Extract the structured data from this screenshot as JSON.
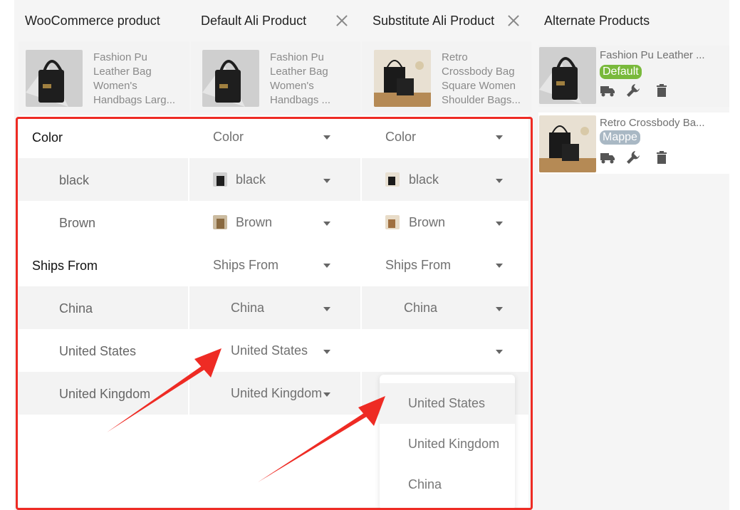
{
  "columns": {
    "woo": "WooCommerce product",
    "default": "Default Ali Product",
    "substitute": "Substitute Ali Product",
    "alternates": "Alternate Products"
  },
  "products": {
    "woo": [
      "Fashion Pu",
      "Leather Bag",
      "Women's",
      "Handbags Larg..."
    ],
    "default": [
      "Fashion Pu",
      "Leather Bag",
      "Women's",
      "Handbags ..."
    ],
    "substitute": [
      "Retro",
      "Crossbody Bag",
      "Square Women",
      "Shoulder Bags..."
    ]
  },
  "attributes": {
    "color": {
      "label": "Color",
      "default_select": "Color",
      "substitute_select": "Color",
      "options": [
        {
          "label": "black",
          "default_value": "black",
          "substitute_value": "black"
        },
        {
          "label": "Brown",
          "default_value": "Brown",
          "substitute_value": "Brown"
        }
      ]
    },
    "ships_from": {
      "label": "Ships From",
      "default_select": "Ships From",
      "substitute_select": "Ships From",
      "options": [
        {
          "label": "China",
          "default_value": "China",
          "substitute_value": "China"
        },
        {
          "label": "United States",
          "default_value": "United States",
          "substitute_value": ""
        },
        {
          "label": "United Kingdom",
          "default_value": "United Kingdom",
          "substitute_value": ""
        }
      ]
    }
  },
  "dropdown": {
    "options": [
      "United States",
      "United Kingdom",
      "China"
    ]
  },
  "alternates": [
    {
      "title": "Fashion Pu Leather ...",
      "badge": "Default",
      "badge_color": "#79b93b"
    },
    {
      "title": "Retro Crossbody Ba...",
      "badge": "Mappe",
      "badge_color": "#a9b8c4"
    }
  ],
  "colors": {
    "highlight": "#ee2b24",
    "default_badge": "#79b93b",
    "mapped_badge": "#a9b8c4"
  },
  "icons": [
    "close-icon",
    "truck-icon",
    "wrench-icon",
    "trash-icon",
    "caret-down-icon"
  ]
}
